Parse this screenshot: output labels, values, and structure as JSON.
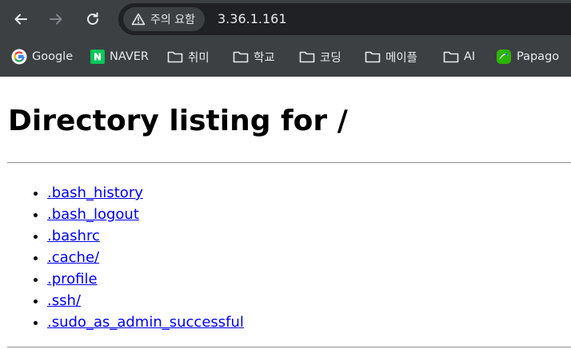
{
  "browser": {
    "security_label": "주의 요함",
    "url": "3.36.1.161",
    "bookmarks": [
      {
        "label": "Google",
        "icon": "google-icon"
      },
      {
        "label": "NAVER",
        "icon": "naver-icon"
      },
      {
        "label": "취미",
        "icon": "folder-icon"
      },
      {
        "label": "학교",
        "icon": "folder-icon"
      },
      {
        "label": "코딩",
        "icon": "folder-icon"
      },
      {
        "label": "메이플",
        "icon": "folder-icon"
      },
      {
        "label": "AI",
        "icon": "folder-icon"
      },
      {
        "label": "Papago",
        "icon": "papago-icon"
      }
    ]
  },
  "page": {
    "heading": "Directory listing for /",
    "entries": [
      ".bash_history",
      ".bash_logout",
      ".bashrc",
      ".cache/",
      ".profile",
      ".ssh/",
      ".sudo_as_admin_successful"
    ]
  },
  "colors": {
    "chrome_bg": "#3c4043",
    "omnibox_bg": "#202124",
    "link": "#0000ee",
    "naver_green": "#03c75a"
  }
}
